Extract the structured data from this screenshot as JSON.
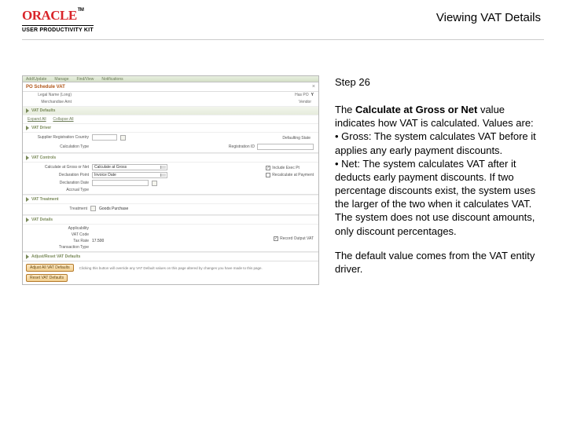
{
  "header": {
    "brand": "ORACLE",
    "subbrand": "USER PRODUCTIVITY KIT",
    "title": "Viewing VAT Details"
  },
  "right": {
    "step": "Step 26",
    "p1_pre": "The ",
    "p1_bold": "Calculate at Gross or Net",
    "p1_post": " value indicates how VAT is calculated. Values are:",
    "bullet1": "• Gross: The system calculates VAT before it applies any early payment discounts.",
    "bullet2": "• Net: The system calculates VAT after it deducts early payment discounts. If two percentage discounts exist, the system uses the larger of the two when it calculates VAT. The system does not use discount amounts, only discount percentages.",
    "p2": "The default value comes from the VAT entity driver."
  },
  "app": {
    "tabs": [
      "Add/Update",
      "Manage",
      "Find/View",
      "Notifications"
    ],
    "windowTitle": "PO Schedule VAT",
    "close": "×",
    "hdr": {
      "legalLab": "Legal Name (Long)",
      "legalVal": "",
      "merchLab": "Merchandise Amt",
      "merchVal": "",
      "haspoLab": "Has PO",
      "haspoVal": "Y",
      "vendorLab": "Vendor",
      "vendorVal": ""
    },
    "s_defaults": {
      "title": "VAT Defaults",
      "expandLab": "Expand All",
      "collapseLab": "Collapse All"
    },
    "s_driver": {
      "title": "VAT Driver",
      "supCountryLab": "Supplier Registration Country",
      "supCountryVal": "",
      "defStateLab": "Defaulting State",
      "defStateVal": "",
      "regIdLab": "Registration ID",
      "regIdVal": "",
      "calcLab": "Calculation Type",
      "calcVal": ""
    },
    "s_controls": {
      "title": "VAT Controls",
      "calcGrossLab": "Calculate at Gross or Net",
      "calcGrossVal": "Calculate at Gross",
      "declPointLab": "Declaration Point",
      "declPointVal": "Invoice Date",
      "declDateLab": "Declaration Date",
      "declDateVal": "",
      "acctTypeLab": "Accrual Type",
      "acctTypeVal": "",
      "incExecLab": "Include Exec Pt",
      "recalcLab": "Recalculate at Payment"
    },
    "s_treat": {
      "title": "VAT Treatment",
      "treatLab": "Treatment",
      "treatVal": "Goods Purchase"
    },
    "s_details": {
      "title": "VAT Details",
      "applLab": "Applicability",
      "applVal": "",
      "codeLab": "VAT Code",
      "codeVal": "",
      "taxRateLab": "Tax Rate",
      "taxRateVal": "17.500",
      "txnTypeLab": "Transaction Type",
      "txnTypeVal": "",
      "recordOutLab": "Record Output VAT"
    },
    "s_adjust": {
      "title": "Adjust/Reset VAT Defaults",
      "btn1": "Adjust All VAT Defaults",
      "btn2": "Reset VAT Defaults",
      "note": "Clicking this button will override any VAT Default values on this page altered by changes you have made to this page."
    }
  }
}
